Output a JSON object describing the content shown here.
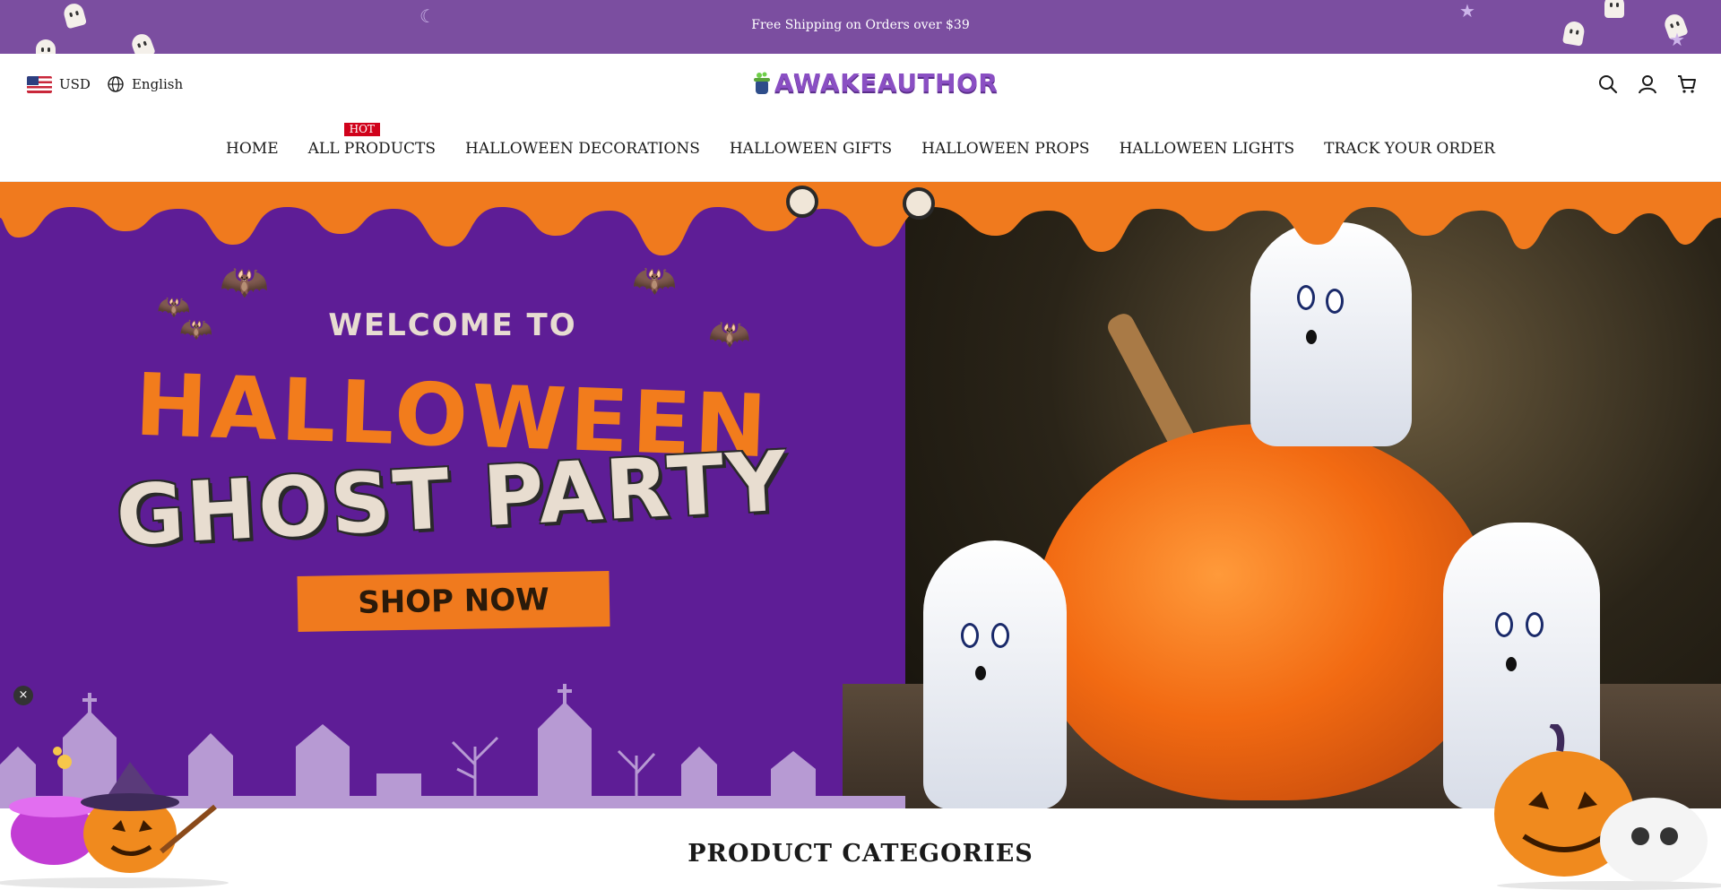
{
  "announcement": {
    "text": "Free Shipping on Orders over $39"
  },
  "header": {
    "currency": "USD",
    "language": "English",
    "logo_text": "AWAKEAUTHOR",
    "icons": [
      "search-icon",
      "account-icon",
      "cart-icon"
    ]
  },
  "nav": {
    "items": [
      {
        "label": "HOME"
      },
      {
        "label": "ALL PRODUCTS",
        "badge": "HOT"
      },
      {
        "label": "HALLOWEEN DECORATIONS"
      },
      {
        "label": "HALLOWEEN GIFTS"
      },
      {
        "label": "HALLOWEEN PROPS"
      },
      {
        "label": "HALLOWEEN LIGHTS"
      },
      {
        "label": "TRACK YOUR ORDER"
      }
    ]
  },
  "hero": {
    "welcome": "WELCOME TO",
    "title_line1": "HALLOWEEN",
    "title_line2": "GHOST PARTY",
    "cta": "SHOP NOW"
  },
  "popup": {
    "close_label": "×"
  },
  "section": {
    "title": "PRODUCT CATEGORIES"
  },
  "colors": {
    "announcement_bg": "#7b4ea0",
    "hero_purple": "#5e1d96",
    "hero_orange": "#f27c1c",
    "hot_badge": "#d0021b",
    "logo": "#8a4fc3"
  }
}
